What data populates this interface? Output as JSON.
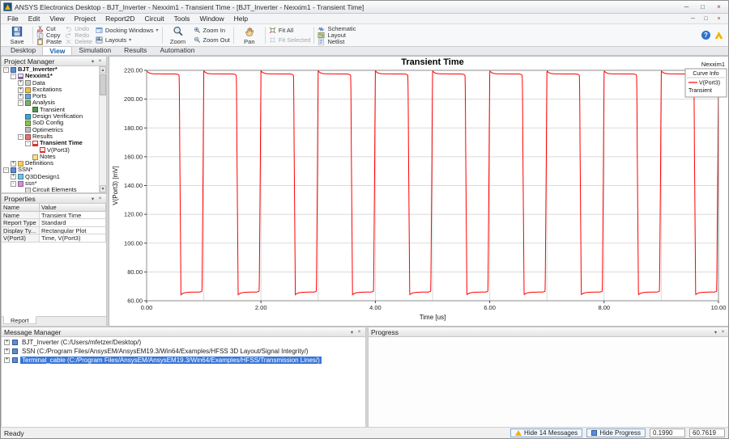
{
  "window": {
    "title": "ANSYS Electronics Desktop - BJT_Inverter - Nexxim1 - Transient Time - [BJT_Inverter - Nexxim1 - Transient Time]"
  },
  "icons": {
    "minimize": "─",
    "maximize": "□",
    "close": "×",
    "dropdown": "▾",
    "menu_arrow": "▾",
    "panel_close": "×",
    "expander_collapsed": "+",
    "expander_expanded": "-",
    "scroll_up": "▲",
    "scroll_down": "▼",
    "help": "?"
  },
  "menubar": {
    "items": [
      "File",
      "Edit",
      "View",
      "Project",
      "Report2D",
      "Circuit",
      "Tools",
      "Window",
      "Help"
    ]
  },
  "ribbon": {
    "save": "Save",
    "cut": "Cut",
    "copy": "Copy",
    "paste": "Paste",
    "undo": "Undo",
    "redo": "Redo",
    "delete": "Delete",
    "docking_windows": "Docking Windows",
    "layouts": "Layouts",
    "zoom": "Zoom",
    "zoom_in": "Zoom In",
    "zoom_out": "Zoom Out",
    "pan": "Pan",
    "fit_all": "Fit All",
    "fit_selected": "Fit Selected",
    "schematic": "Schematic",
    "layout": "Layout",
    "netlist": "Netlist"
  },
  "ribbon_tabs": {
    "items": [
      "Desktop",
      "View",
      "Simulation",
      "Results",
      "Automation"
    ],
    "active": "View"
  },
  "project_manager": {
    "title": "Project Manager",
    "tree": [
      {
        "depth": 0,
        "expander": "-",
        "icon": "project",
        "label": "BJT_Inverter*",
        "bold": true
      },
      {
        "depth": 1,
        "expander": "-",
        "icon": "design",
        "label": "Nexxim1*",
        "bold": true
      },
      {
        "depth": 2,
        "expander": "+",
        "icon": "data",
        "label": "Data"
      },
      {
        "depth": 2,
        "expander": "+",
        "icon": "excitations",
        "label": "Excitations"
      },
      {
        "depth": 2,
        "expander": "+",
        "icon": "ports",
        "label": "Ports"
      },
      {
        "depth": 2,
        "expander": "-",
        "icon": "analysis",
        "label": "Analysis"
      },
      {
        "depth": 3,
        "expander": null,
        "icon": "setup",
        "label": "Transient"
      },
      {
        "depth": 2,
        "expander": null,
        "icon": "verification",
        "label": "Design Verification"
      },
      {
        "depth": 2,
        "expander": null,
        "icon": "config",
        "label": "SoD Config"
      },
      {
        "depth": 2,
        "expander": null,
        "icon": "optimetrics",
        "label": "Optimetrics"
      },
      {
        "depth": 2,
        "expander": "-",
        "icon": "results",
        "label": "Results"
      },
      {
        "depth": 3,
        "expander": "-",
        "icon": "plot",
        "label": "Transient Time",
        "bold": true
      },
      {
        "depth": 4,
        "expander": null,
        "icon": "trace",
        "label": "V(Port3)"
      },
      {
        "depth": 3,
        "expander": null,
        "icon": "notes",
        "label": "Notes"
      },
      {
        "depth": 1,
        "expander": "+",
        "icon": "definitions",
        "label": "Definitions"
      },
      {
        "depth": 0,
        "expander": "-",
        "icon": "project",
        "label": "SSN*"
      },
      {
        "depth": 1,
        "expander": "+",
        "icon": "q3d",
        "label": "Q3DDesign1"
      },
      {
        "depth": 1,
        "expander": "-",
        "icon": "layoutdesign",
        "label": "ssn*"
      },
      {
        "depth": 2,
        "expander": null,
        "icon": "circuit",
        "label": "Circuit Elements"
      }
    ]
  },
  "properties": {
    "title": "Properties",
    "columns": [
      "Name",
      "Value"
    ],
    "rows": [
      [
        "Name",
        "Transient Time"
      ],
      [
        "Report Type",
        "Standard"
      ],
      [
        "Display Ty...",
        "Rectangular Plot"
      ],
      [
        "V(Port3)",
        "Time, V(Port3)"
      ]
    ],
    "tab": "Report"
  },
  "message_manager": {
    "title": "Message Manager",
    "messages": [
      {
        "text": "BJT_Inverter (C:/Users/mfetzer/Desktop/)",
        "selected": false
      },
      {
        "text": "SSN (C:/Program Files/AnsysEM/AnsysEM19.3/Win64/Examples/HFSS 3D Layout/Signal Integrity/)",
        "selected": false
      },
      {
        "text": "Terminal_cable (C:/Program Files/AnsysEM/AnsysEM19.3/Win64/Examples/HFSS/Transmission Lines/)",
        "selected": true
      }
    ]
  },
  "progress": {
    "title": "Progress"
  },
  "statusbar": {
    "ready": "Ready",
    "hide_messages": "Hide 14 Messages",
    "hide_progress": "Hide Progress",
    "value1": "0.1990",
    "value2": "60.7619"
  },
  "chart_data": {
    "type": "line",
    "title": "Transient Time",
    "xlabel": "Time [us]",
    "ylabel": "V(Port3) [mV]",
    "xlim": [
      0,
      10
    ],
    "ylim": [
      60,
      220
    ],
    "xticks": [
      0,
      2,
      4,
      6,
      8,
      10
    ],
    "yticks": [
      60,
      80,
      100,
      120,
      140,
      160,
      180,
      200,
      220
    ],
    "x_grid_step": 1,
    "grid": true,
    "legend_position": "top-right",
    "legend": {
      "design": "Nexxim1",
      "header": "Curve Info",
      "trace": "V(Port3)",
      "sweep": "Transient"
    },
    "series": [
      {
        "name": "V(Port3)",
        "color": "#ff0000",
        "waveform": "square",
        "high_mV": 217.5,
        "low_mV": 66,
        "period_us": 1.0,
        "duty_high": 0.57,
        "edge_us": 0.03,
        "t_start_us": 0,
        "t_end_us": 10,
        "phase": "starts_high"
      }
    ]
  }
}
